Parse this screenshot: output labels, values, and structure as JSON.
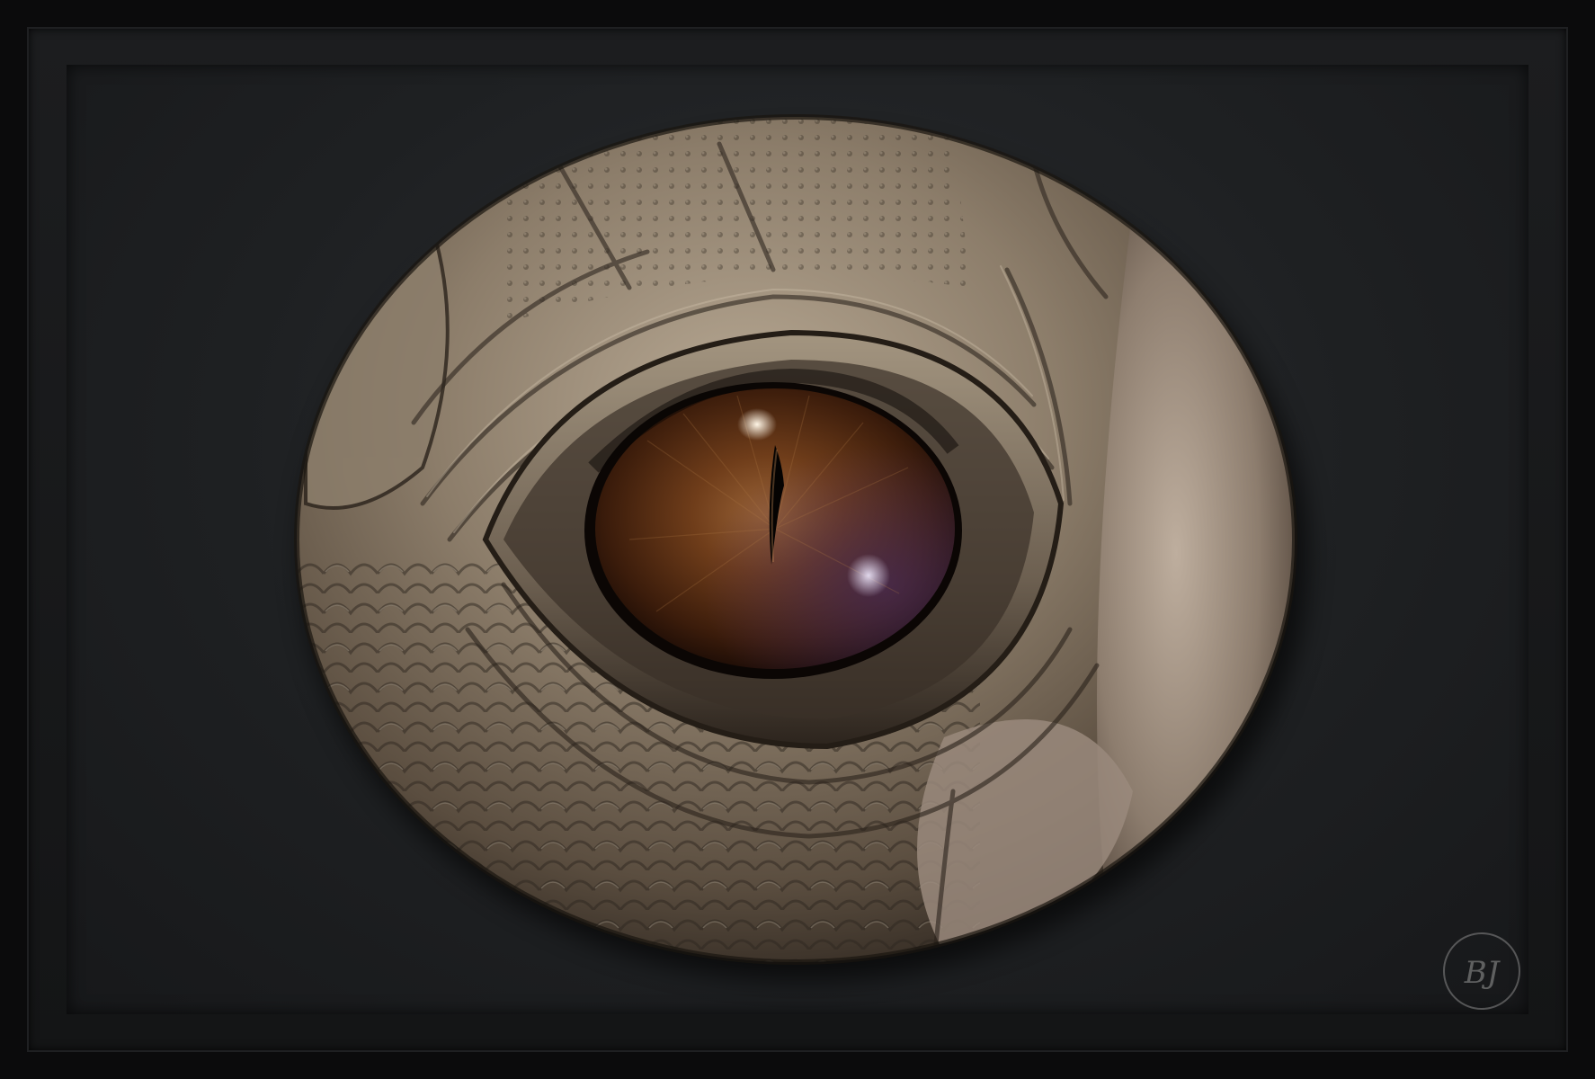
{
  "artwork": {
    "subject": "reptile-eye-sculpture",
    "colors": {
      "frame": "#0b0b0c",
      "mat": "#1e2022",
      "skin_light": "#b3a48f",
      "skin_mid": "#7d6f5d",
      "skin_dark": "#3a3128",
      "iris": "#6b3a18",
      "iris_dark": "#1e0e06",
      "pupil": "#050302"
    }
  },
  "signature": {
    "monogram": "BJ"
  }
}
